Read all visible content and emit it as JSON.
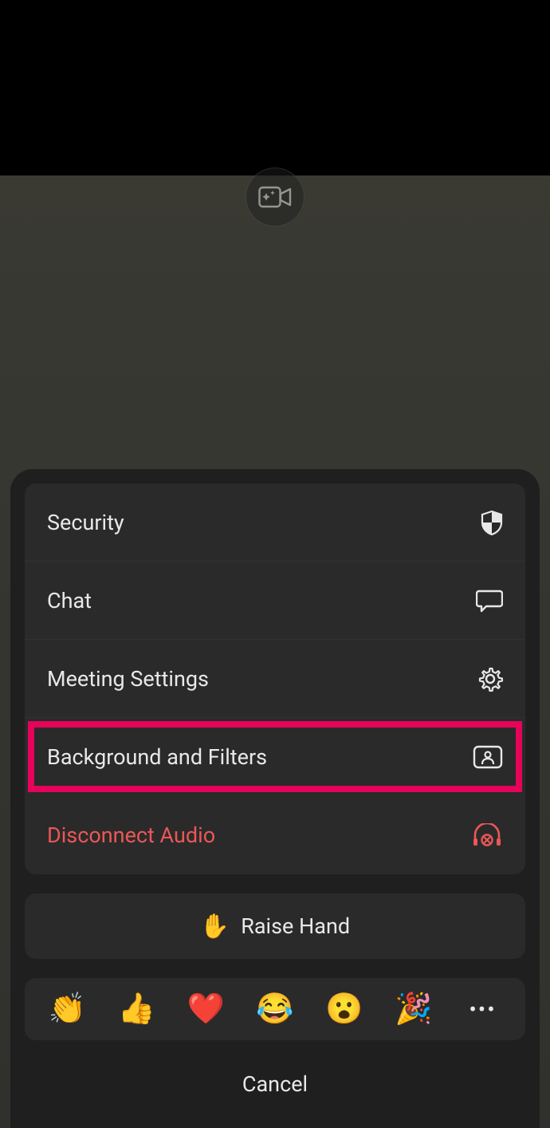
{
  "menu": {
    "items": [
      {
        "label": "Security"
      },
      {
        "label": "Chat"
      },
      {
        "label": "Meeting Settings"
      },
      {
        "label": "Background and Filters"
      },
      {
        "label": "Disconnect Audio"
      }
    ]
  },
  "raise_hand": {
    "label": "Raise Hand",
    "emoji": "✋"
  },
  "reactions": {
    "items": [
      "👏",
      "👍",
      "❤️",
      "😂",
      "😮",
      "🎉"
    ]
  },
  "cancel_label": "Cancel"
}
